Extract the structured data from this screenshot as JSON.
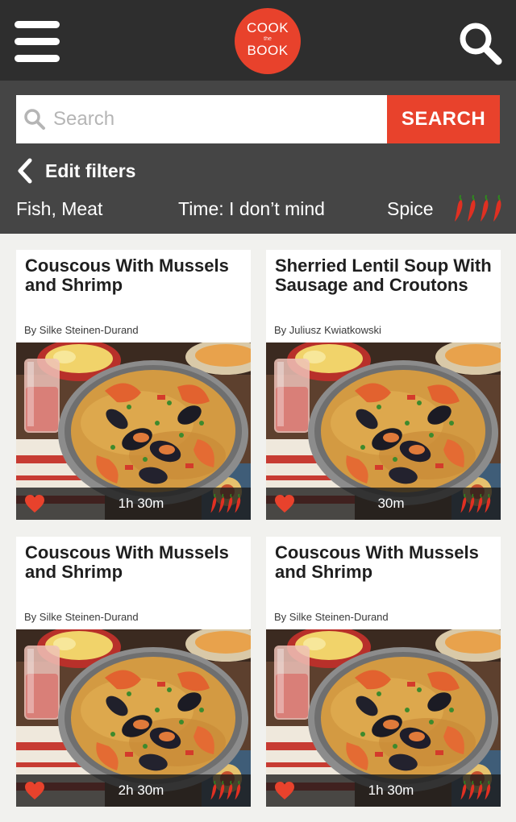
{
  "app": {
    "logo_top": "COOK",
    "logo_mid": "the",
    "logo_bottom": "BOOK"
  },
  "search": {
    "placeholder": "Search",
    "value": "",
    "button_label": "SEARCH"
  },
  "filters": {
    "edit_label": "Edit filters",
    "category": "Fish, Meat",
    "time": "Time: I don’t mind",
    "spice_label": "Spice",
    "spice_level": 4
  },
  "recipes": [
    {
      "title": "Couscous With Mussels and Shrimp",
      "author": "By Silke Steinen-Durand",
      "time": "1h 30m",
      "spice_level": 4
    },
    {
      "title": "Sherried Lentil Soup With Sausage and Croutons",
      "author": "By Juliusz Kwiatkowski",
      "time": "30m",
      "spice_level": 4
    },
    {
      "title": "Couscous With Mussels and Shrimp",
      "author": "By Silke Steinen-Durand",
      "time": "2h 30m",
      "spice_level": 4
    },
    {
      "title": "Couscous With Mussels and Shrimp",
      "author": "By Silke Steinen-Durand",
      "time": "1h 30m",
      "spice_level": 4
    }
  ],
  "icons": {
    "menu": "hamburger-menu-icon",
    "search": "magnifier-icon",
    "back": "chevron-left-icon",
    "favorite": "heart-icon",
    "spice": "chili-pepper-icon"
  },
  "colors": {
    "accent": "#e8422c",
    "topbar": "#2e2e2e",
    "filter_panel": "#454545",
    "background": "#f1f1ee"
  }
}
